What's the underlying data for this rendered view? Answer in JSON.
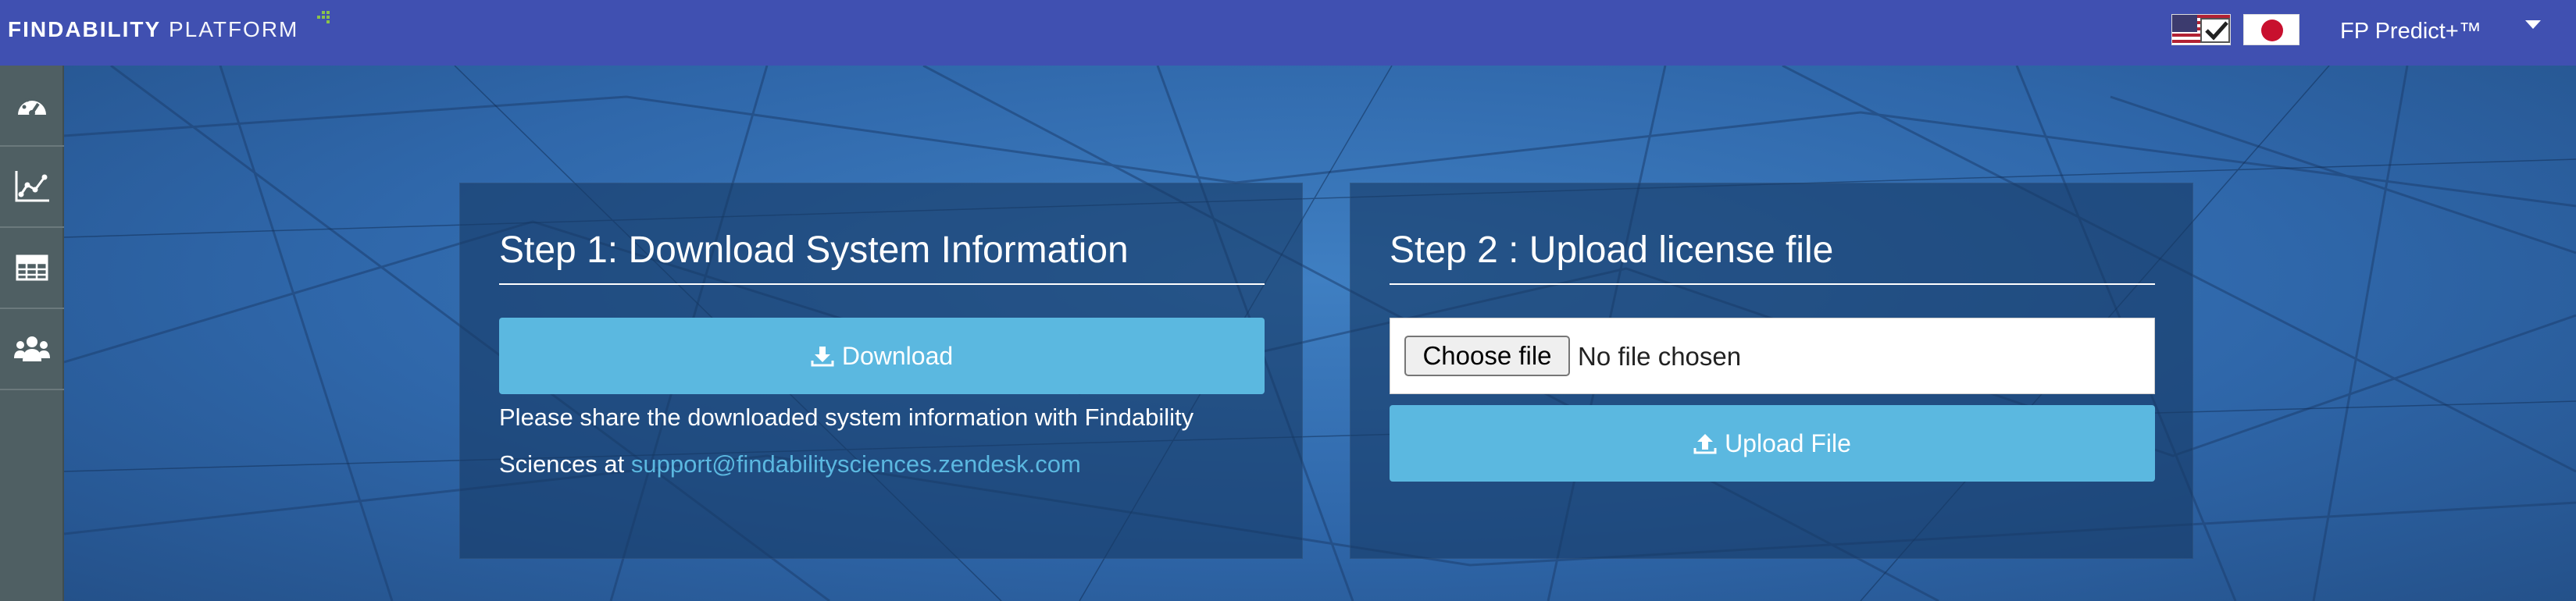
{
  "header": {
    "logo_bold": "FINDABILITY",
    "logo_light": "PLATFORM",
    "language_flags": [
      "us-flag-icon",
      "japan-flag-icon"
    ],
    "product": "FP Predict+™",
    "brand_color": "#4050b1"
  },
  "sidebar": {
    "items": [
      "dashboard-icon",
      "chart-icon",
      "table-icon",
      "users-icon"
    ]
  },
  "step1": {
    "title": "Step 1: Download System Information",
    "download_label": "Download",
    "info_text": "Please share the downloaded system information with Findability Sciences at ",
    "support_email": "support@findabilitysciences.zendesk.com"
  },
  "step2": {
    "title": "Step 2 : Upload license file",
    "choose_file_label": "Choose file",
    "no_file_text": "No file chosen",
    "upload_label": "Upload File"
  },
  "colors": {
    "button": "#5bb8e0",
    "sidebar": "#4f5f63"
  }
}
